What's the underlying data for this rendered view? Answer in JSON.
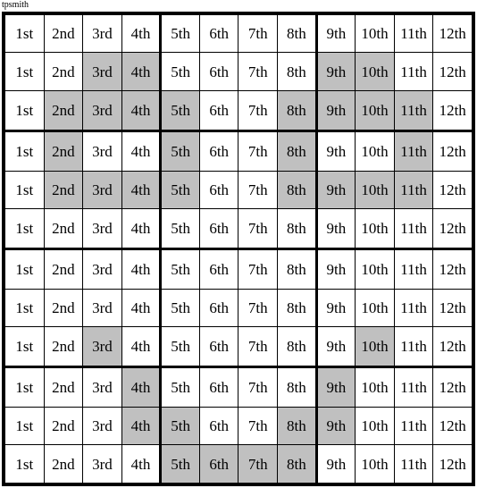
{
  "corner_label": "tpsmith",
  "grid": {
    "rows": 12,
    "columns": 12,
    "column_labels": [
      "1st",
      "2nd",
      "3rd",
      "4th",
      "5th",
      "6th",
      "7th",
      "8th",
      "9th",
      "10th",
      "11th",
      "12th"
    ],
    "colors": {
      "shaded": "#c0c0c0",
      "unshaded": "#ffffff",
      "border": "#000000",
      "text": "#000000"
    },
    "block_column_breaks": [
      4,
      8
    ],
    "block_row_breaks": [
      3,
      6,
      9
    ],
    "shaded_cells_by_row": [
      [],
      [
        3,
        4,
        9,
        10
      ],
      [
        2,
        3,
        4,
        5,
        8,
        9,
        10,
        11
      ],
      [
        2,
        5,
        8,
        11
      ],
      [
        2,
        3,
        4,
        5,
        8,
        9,
        10,
        11
      ],
      [],
      [],
      [],
      [
        3,
        10
      ],
      [
        4,
        9
      ],
      [
        4,
        5,
        8,
        9
      ],
      [
        5,
        6,
        7,
        8
      ]
    ]
  }
}
